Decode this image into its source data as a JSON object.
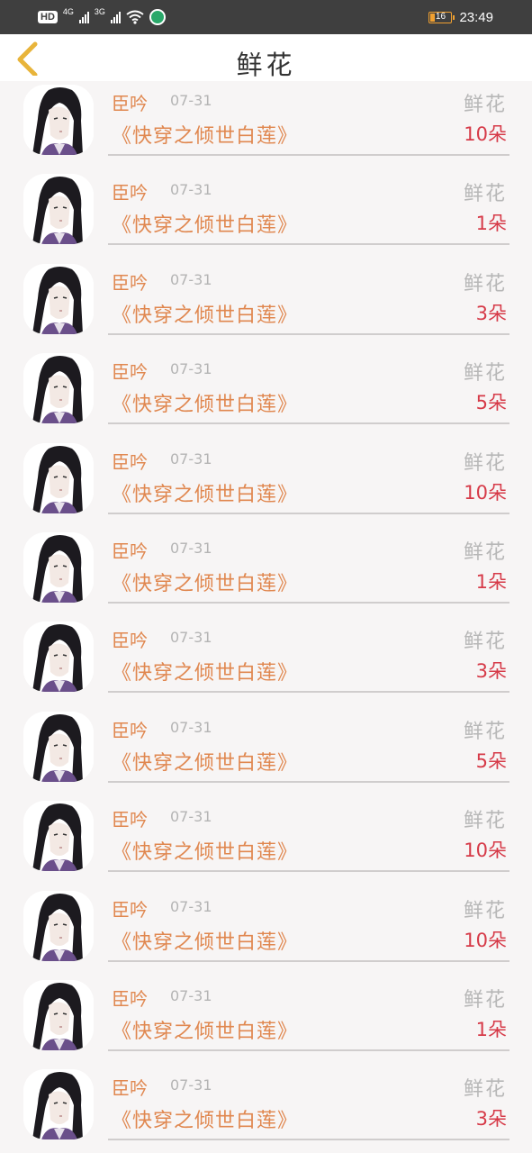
{
  "status_bar": {
    "hd_label": "HD",
    "net1": "4G",
    "net2": "3G",
    "battery": "16",
    "time": "23:49"
  },
  "header": {
    "title": "鲜花"
  },
  "records": [
    {
      "user": "臣吟",
      "date": "07-31",
      "book": "《快穿之倾世白莲》",
      "gift": "鲜花",
      "count": "10朵"
    },
    {
      "user": "臣吟",
      "date": "07-31",
      "book": "《快穿之倾世白莲》",
      "gift": "鲜花",
      "count": "1朵"
    },
    {
      "user": "臣吟",
      "date": "07-31",
      "book": "《快穿之倾世白莲》",
      "gift": "鲜花",
      "count": "3朵"
    },
    {
      "user": "臣吟",
      "date": "07-31",
      "book": "《快穿之倾世白莲》",
      "gift": "鲜花",
      "count": "5朵"
    },
    {
      "user": "臣吟",
      "date": "07-31",
      "book": "《快穿之倾世白莲》",
      "gift": "鲜花",
      "count": "10朵"
    },
    {
      "user": "臣吟",
      "date": "07-31",
      "book": "《快穿之倾世白莲》",
      "gift": "鲜花",
      "count": "1朵"
    },
    {
      "user": "臣吟",
      "date": "07-31",
      "book": "《快穿之倾世白莲》",
      "gift": "鲜花",
      "count": "3朵"
    },
    {
      "user": "臣吟",
      "date": "07-31",
      "book": "《快穿之倾世白莲》",
      "gift": "鲜花",
      "count": "5朵"
    },
    {
      "user": "臣吟",
      "date": "07-31",
      "book": "《快穿之倾世白莲》",
      "gift": "鲜花",
      "count": "10朵"
    },
    {
      "user": "臣吟",
      "date": "07-31",
      "book": "《快穿之倾世白莲》",
      "gift": "鲜花",
      "count": "10朵"
    },
    {
      "user": "臣吟",
      "date": "07-31",
      "book": "《快穿之倾世白莲》",
      "gift": "鲜花",
      "count": "1朵"
    },
    {
      "user": "臣吟",
      "date": "07-31",
      "book": "《快穿之倾世白莲》",
      "gift": "鲜花",
      "count": "3朵"
    }
  ],
  "colors": {
    "status_bar_bg": "#3f3f3f",
    "back_arrow": "#e8b43a",
    "orange_text": "#e0874f",
    "count_red": "#d63a48",
    "gray_text": "#b7b7b7"
  },
  "icons": {
    "back": "chevron-left-icon",
    "avatar": "avatar-image"
  }
}
